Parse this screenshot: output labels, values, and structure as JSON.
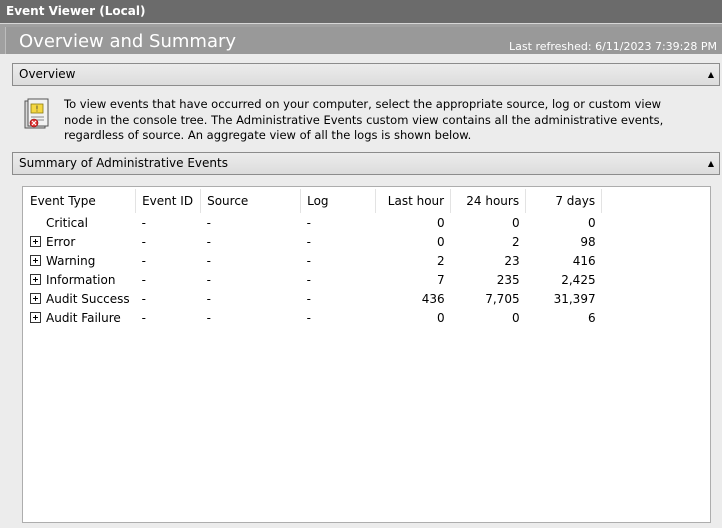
{
  "window": {
    "title": "Event Viewer (Local)"
  },
  "header": {
    "title": "Overview and Summary",
    "last_refreshed": "Last refreshed: 6/11/2023 7:39:28 PM"
  },
  "overview": {
    "section_label": "Overview",
    "text": "To view events that have occurred on your computer, select the appropriate source, log or custom view node in the console tree. The Administrative Events custom view contains all the administrative events, regardless of source. An aggregate view of all the logs is shown below.",
    "icon": "event-log-icon"
  },
  "summary": {
    "section_label": "Summary of Administrative Events",
    "columns": [
      "Event Type",
      "Event ID",
      "Source",
      "Log",
      "Last hour",
      "24 hours",
      "7 days"
    ],
    "rows": [
      {
        "type": "Critical",
        "id": "-",
        "source": "-",
        "log": "-",
        "last_hour": "0",
        "h24": "0",
        "d7": "0",
        "expandable": false
      },
      {
        "type": "Error",
        "id": "-",
        "source": "-",
        "log": "-",
        "last_hour": "0",
        "h24": "2",
        "d7": "98",
        "expandable": true
      },
      {
        "type": "Warning",
        "id": "-",
        "source": "-",
        "log": "-",
        "last_hour": "2",
        "h24": "23",
        "d7": "416",
        "expandable": true
      },
      {
        "type": "Information",
        "id": "-",
        "source": "-",
        "log": "-",
        "last_hour": "7",
        "h24": "235",
        "d7": "2,425",
        "expandable": true
      },
      {
        "type": "Audit Success",
        "id": "-",
        "source": "-",
        "log": "-",
        "last_hour": "436",
        "h24": "7,705",
        "d7": "31,397",
        "expandable": true
      },
      {
        "type": "Audit Failure",
        "id": "-",
        "source": "-",
        "log": "-",
        "last_hour": "0",
        "h24": "0",
        "d7": "6",
        "expandable": true
      }
    ]
  },
  "colors": {
    "titlebar": "#6b6b6b",
    "header": "#999999",
    "panel": "#ececec"
  }
}
